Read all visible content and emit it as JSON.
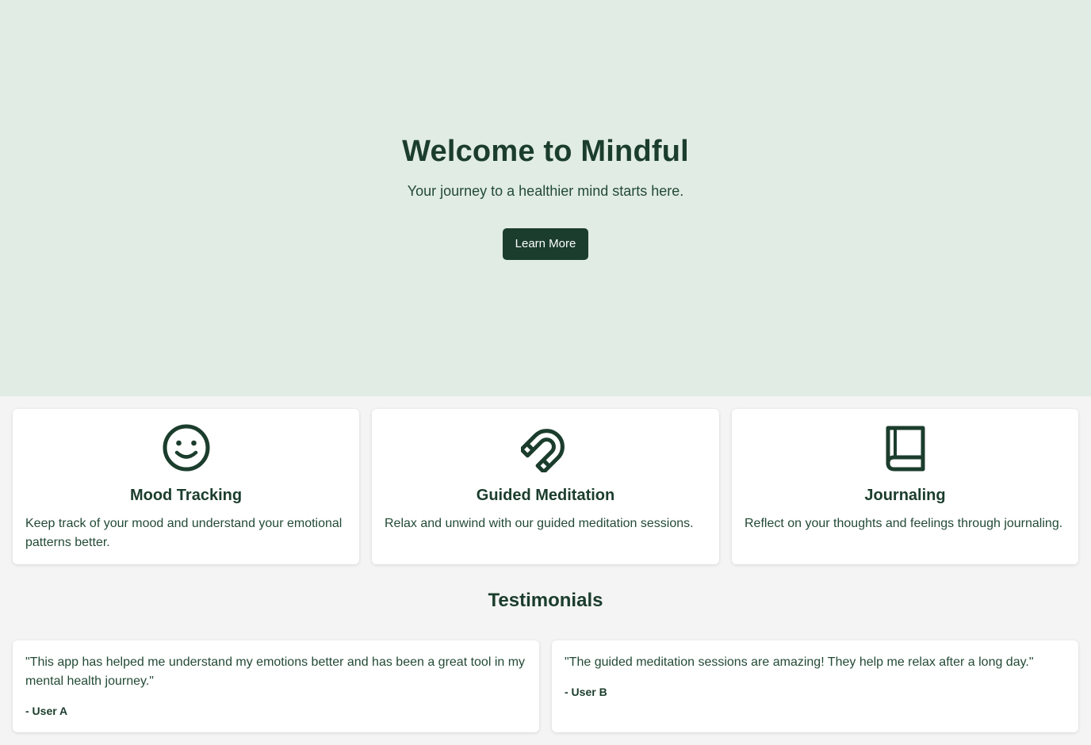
{
  "hero": {
    "title": "Welcome to Mindful",
    "subtitle": "Your journey to a healthier mind starts here.",
    "button_label": "Learn More"
  },
  "features": [
    {
      "icon": "smiley-face-icon",
      "title": "Mood Tracking",
      "description": "Keep track of your mood and understand your emotional patterns better."
    },
    {
      "icon": "magnet-icon",
      "title": "Guided Meditation",
      "description": "Relax and unwind with our guided meditation sessions."
    },
    {
      "icon": "book-icon",
      "title": "Journaling",
      "description": "Reflect on your thoughts and feelings through journaling."
    }
  ],
  "testimonials": {
    "heading": "Testimonials",
    "items": [
      {
        "quote": "\"This app has helped me understand my emotions better and has been a great tool in my mental health journey.\"",
        "author": "- User A"
      },
      {
        "quote": "\"The guided meditation sessions are amazing! They help me relax after a long day.\"",
        "author": "- User B"
      }
    ]
  },
  "colors": {
    "primary": "#1b3d2d",
    "hero_background": "#e1ece4",
    "page_background": "#f4f4f4",
    "card_background": "#ffffff"
  }
}
